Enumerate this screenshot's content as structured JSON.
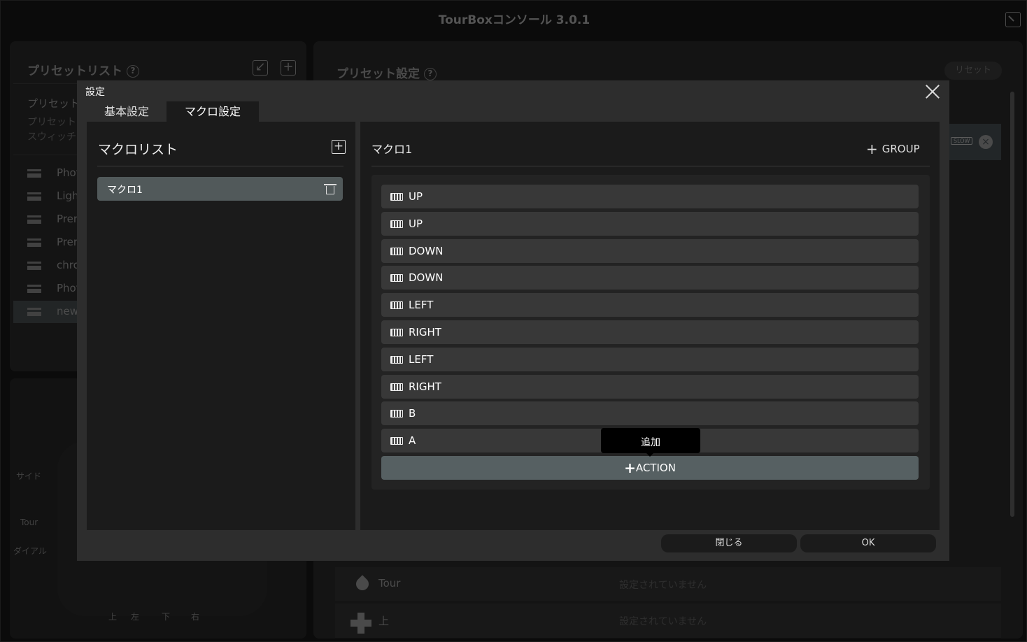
{
  "app": {
    "title": "TourBoxコンソール 3.0.1"
  },
  "preset_list": {
    "title": "プリセットリスト",
    "help": "?",
    "preset_label": "プリセット",
    "sub1": "プリセット",
    "sub2": "スウィッチ",
    "items": [
      "Phot",
      "Ligh",
      "Prer",
      "Prer",
      "chro",
      "Phot",
      "new"
    ]
  },
  "device": {
    "labels": {
      "side": "サイド",
      "tour": "Tour",
      "dial": "ダイアル",
      "up": "上",
      "left": "左",
      "down": "下",
      "right": "右"
    }
  },
  "preset_settings": {
    "title": "プリセット設定",
    "help": "?",
    "reset": "リセット",
    "slow": "SLOW",
    "rows": [
      {
        "label": "Tour",
        "value": "設定されていません"
      },
      {
        "label": "上",
        "value": "設定されていません"
      }
    ]
  },
  "dialog": {
    "title": "設定",
    "tabs": [
      "基本設定",
      "マクロ設定"
    ],
    "macro_list": {
      "title": "マクロリスト",
      "items": [
        "マクロ1"
      ]
    },
    "macro_edit": {
      "title": "マクロ1",
      "group_label": "GROUP",
      "actions": [
        "UP",
        "UP",
        "DOWN",
        "DOWN",
        "LEFT",
        "RIGHT",
        "LEFT",
        "RIGHT",
        "B",
        "A"
      ],
      "add_action_label": "ACTION",
      "tooltip": "追加"
    },
    "close_label": "閉じる",
    "ok_label": "OK"
  }
}
